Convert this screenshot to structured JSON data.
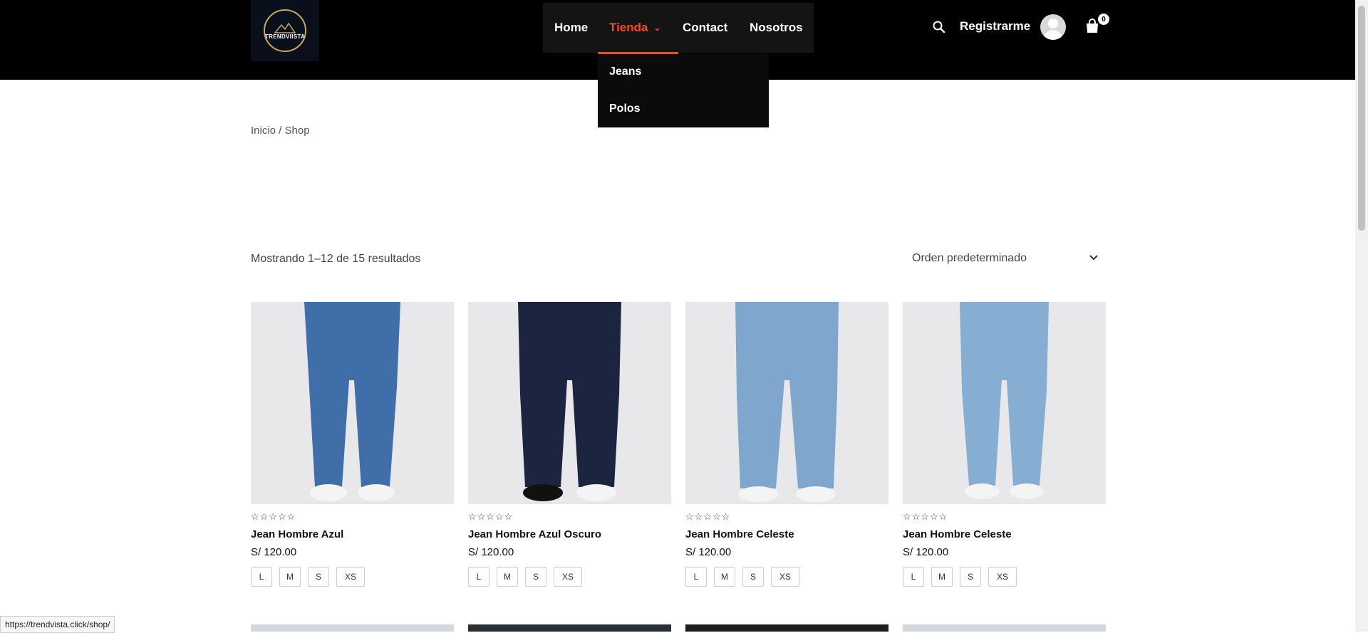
{
  "header": {
    "logo_text": "TRENDVIISTA",
    "nav": [
      {
        "label": "Home"
      },
      {
        "label": "Tienda"
      },
      {
        "label": "Contact"
      },
      {
        "label": "Nosotros"
      }
    ],
    "dropdown": [
      "Jeans",
      "Polos"
    ],
    "register_label": "Registrarme",
    "cart_count": "0",
    "accent_color": "#f04f19"
  },
  "breadcrumb": "Inicio / Shop",
  "result_count": "Mostrando 1–12 de 15 resultados",
  "orderby": {
    "selected": "Orden predeterminado"
  },
  "products": [
    {
      "name": "Jean Hombre Azul",
      "price": "S/ 120.00",
      "stars": "☆☆☆☆☆",
      "sizes": [
        "L",
        "M",
        "S",
        "XS"
      ],
      "jean_color": "#3f6ea8"
    },
    {
      "name": "Jean Hombre Azul Oscuro",
      "price": "S/ 120.00",
      "stars": "☆☆☆☆☆",
      "sizes": [
        "L",
        "M",
        "S",
        "XS"
      ],
      "jean_color": "#1c2540"
    },
    {
      "name": "Jean Hombre Celeste",
      "price": "S/ 120.00",
      "stars": "☆☆☆☆☆",
      "sizes": [
        "L",
        "M",
        "S",
        "XS"
      ],
      "jean_color": "#7fa6cc"
    },
    {
      "name": "Jean Hombre Celeste",
      "price": "S/ 120.00",
      "stars": "☆☆☆☆☆",
      "sizes": [
        "L",
        "M",
        "S",
        "XS"
      ],
      "jean_color": "#86aed3"
    }
  ],
  "status_url": "https://trendvista.click/shop/"
}
